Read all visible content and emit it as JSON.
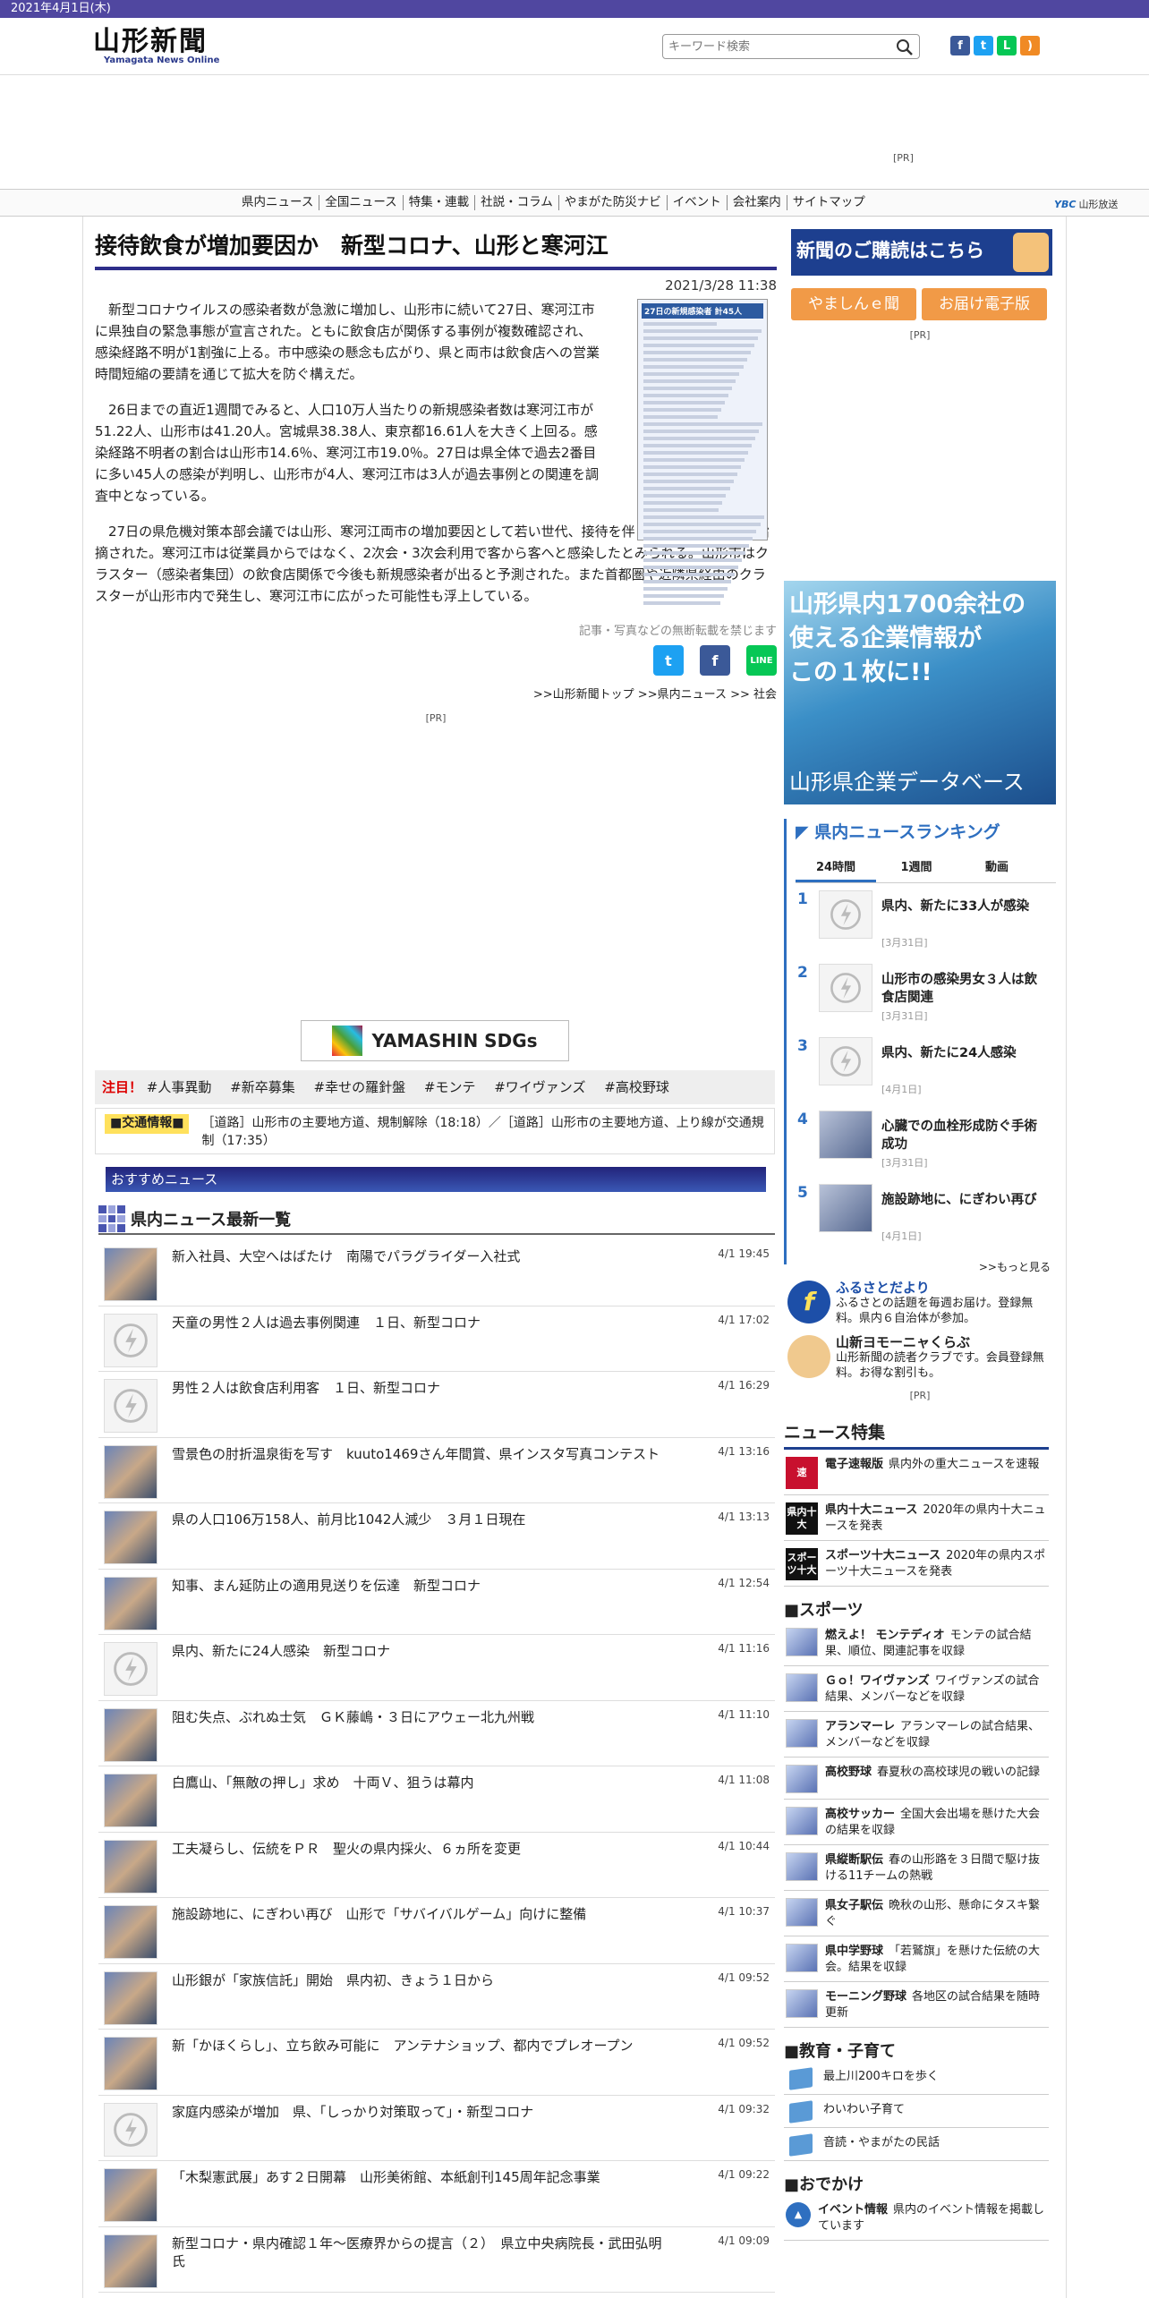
{
  "topbar": {
    "date": "2021年4月1日(木)"
  },
  "header": {
    "logo": "山形新聞",
    "logo_sub": "Yamagata News Online",
    "search_placeholder": "キーワード検索"
  },
  "ads": {
    "pr": "[PR]"
  },
  "nav": {
    "items": [
      "県内ニュース",
      "全国ニュース",
      "特集・連載",
      "社説・コラム",
      "やまがた防災ナビ",
      "イベント",
      "会社案内",
      "サイトマップ"
    ],
    "ybc": "山形放送",
    "ybc_mark": "YBC"
  },
  "article": {
    "title": "接待飲食が増加要因か　新型コロナ、山形と寒河江",
    "date": "2021/3/28 11:38",
    "figure_title": "27日の新規感染者 計45人",
    "paragraphs": [
      "新型コロナウイルスの感染者数が急激に増加し、山形市に続いて27日、寒河江市に県独自の緊急事態が宣言された。ともに飲食店が関係する事例が複数確認され、感染経路不明が1割強に上る。市中感染の懸念も広がり、県と両市は飲食店への営業時間短縮の要請を通じて拡大を防ぐ構えだ。",
      "26日までの直近1週間でみると、人口10万人当たりの新規感染者数は寒河江市が51.22人、山形市は41.20人。宮城県38.38人、東京都16.61人を大きく上回る。感染経路不明者の割合は山形市14.6％、寒河江市19.0％。27日は県全体で過去2番目に多い45人の感染が判明し、山形市が4人、寒河江市は3人が過去事例との関連を調査中となっている。",
      "27日の県危機対策本部会議では山形、寒河江両市の増加要因として若い世代、接待を伴う飲食店での感染が指摘された。寒河江市は従業員からではなく、2次会・3次会利用で客から客へと感染したとみられる。山形市はクラスター（感染者集団）の飲食店関係で今後も新規感染者が出ると予測された。また首都圏や近隣県経由のクラスターが山形市内で発生し、寒河江市に広がった可能性も浮上している。"
    ],
    "no_reprint": "記事・写真などの無断転載を禁じます",
    "breadcrumb": ">>山形新聞トップ >>県内ニュース >> 社会"
  },
  "sdgs": {
    "label": "YAMASHIN SDGs"
  },
  "tags": {
    "label": "注目！",
    "items": [
      "#人事異動",
      "#新卒募集",
      "#幸せの羅針盤",
      "#モンテ",
      "#ワイヴァンズ",
      "#高校野球"
    ]
  },
  "traffic": {
    "label": "■交通情報■",
    "text": "［道路］山形市の主要地方道、規制解除（18:18）／［道路］山形市の主要地方道、上り線が交通規制（17:35）"
  },
  "recommend": {
    "label": "おすすめニュース"
  },
  "news": {
    "heading": "県内ニュース最新一覧",
    "items": [
      {
        "title": "新入社員、大空へはばたけ　南陽でパラグライダー入社式",
        "date": "4/1 19:45",
        "photo": true
      },
      {
        "title": "天童の男性２人は過去事例関連　１日、新型コロナ",
        "date": "4/1 17:02",
        "photo": false
      },
      {
        "title": "男性２人は飲食店利用客　１日、新型コロナ",
        "date": "4/1 16:29",
        "photo": false
      },
      {
        "title": "雪景色の肘折温泉街を写す　kuuto1469さん年間賞、県インスタ写真コンテスト",
        "date": "4/1 13:16",
        "photo": true
      },
      {
        "title": "県の人口106万158人、前月比1042人減少　３月１日現在",
        "date": "4/1 13:13",
        "photo": true
      },
      {
        "title": "知事、まん延防止の適用見送りを伝達　新型コロナ",
        "date": "4/1 12:54",
        "photo": true
      },
      {
        "title": "県内、新たに24人感染　新型コロナ",
        "date": "4/1 11:16",
        "photo": false
      },
      {
        "title": "阻む失点、ぶれぬ士気　ＧＫ藤嶋・３日にアウェー北九州戦",
        "date": "4/1 11:10",
        "photo": true
      },
      {
        "title": "白鷹山、「無敵の押し」求め　十両Ｖ、狙うは幕内",
        "date": "4/1 11:08",
        "photo": true
      },
      {
        "title": "工夫凝らし、伝統をＰＲ　聖火の県内採火、６ヵ所を変更",
        "date": "4/1 10:44",
        "photo": true
      },
      {
        "title": "施設跡地に、にぎわい再び　山形で「サバイバルゲーム」向けに整備",
        "date": "4/1 10:37",
        "photo": true
      },
      {
        "title": "山形銀が「家族信託」開始　県内初、きょう１日から",
        "date": "4/1 09:52",
        "photo": true
      },
      {
        "title": "新「かほくらし」、立ち飲み可能に　アンテナショップ、都内でプレオープン",
        "date": "4/1 09:52",
        "photo": true
      },
      {
        "title": "家庭内感染が増加　県、「しっかり対策取って」・新型コロナ",
        "date": "4/1 09:32",
        "photo": false
      },
      {
        "title": "「木梨憲武展」あす２日開幕　山形美術館、本紙創刊145周年記念事業",
        "date": "4/1 09:22",
        "photo": true
      },
      {
        "title": "新型コロナ・県内確認１年～医療界からの提言（２）　県立中央病院長・武田弘明氏",
        "date": "4/1 09:09",
        "photo": true
      }
    ]
  },
  "sidebar": {
    "subscribe": "新聞のご購読はこちら",
    "buttons": [
      "やましんｅ聞",
      "お届け電子版"
    ],
    "bigad_line1": "山形県内1700余社の",
    "bigad_line2": "使える企業情報が",
    "bigad_line3": "この１枚に!!",
    "bigad_line4": "山形県企業データベース",
    "ranking": {
      "title": "県内ニュースランキング",
      "tabs": [
        "24時間",
        "1週間",
        "動画"
      ],
      "items": [
        {
          "n": "1",
          "title": "県内、新たに33人が感染",
          "date": "[3月31日]",
          "photo": false
        },
        {
          "n": "2",
          "title": "山形市の感染男女３人は飲食店関連",
          "date": "[3月31日]",
          "photo": false
        },
        {
          "n": "3",
          "title": "県内、新たに24人感染",
          "date": "[4月1日]",
          "photo": false
        },
        {
          "n": "4",
          "title": "心臓での血栓形成防ぐ手術成功",
          "date": "[3月31日]",
          "photo": true
        },
        {
          "n": "5",
          "title": "施設跡地に、にぎわい再び",
          "date": "[4月1日]",
          "photo": true
        }
      ],
      "more": ">>もっと見る"
    },
    "furusato": {
      "title": "ふるさとだより",
      "text": "ふるさとの話題を毎週お届け。登録無料。県内６自治体が参加。"
    },
    "club": {
      "title": "山新ヨモーニャくらぶ",
      "text": "山形新聞の読者クラブです。会員登録無料。お得な割引も。"
    },
    "features_title": "ニュース特集",
    "features": [
      {
        "icon": "速",
        "color": "#c8102e",
        "name": "電子速報版",
        "desc": "県内外の重大ニュースを速報"
      },
      {
        "icon": "県内十大",
        "color": "#111",
        "name": "県内十大ニュース",
        "desc": "2020年の県内十大ニュースを発表"
      },
      {
        "icon": "スポーツ十大",
        "color": "#111",
        "name": "スポーツ十大ニュース",
        "desc": "2020年の県内スポーツ十大ニュースを発表"
      }
    ],
    "sports_title": "■スポーツ",
    "sports": [
      {
        "name": "燃えよ！ モンテディオ",
        "desc": "モンテの試合結果、順位、関連記事を収録"
      },
      {
        "name": "Ｇｏ！ワイヴァンズ",
        "desc": "ワイヴァンズの試合結果、メンバーなどを収録"
      },
      {
        "name": "アランマーレ",
        "desc": "アランマーレの試合結果、メンバーなどを収録"
      },
      {
        "name": "高校野球",
        "desc": "春夏秋の高校球児の戦いの記録"
      },
      {
        "name": "高校サッカー",
        "desc": "全国大会出場を懸けた大会の結果を収録"
      },
      {
        "name": "県縦断駅伝",
        "desc": "春の山形路を３日間で駆け抜ける11チームの熱戦"
      },
      {
        "name": "県女子駅伝",
        "desc": "晩秋の山形、懸命にタスキ繋ぐ"
      },
      {
        "name": "県中学野球",
        "desc": "「若鷲旗」を懸けた伝統の大会。結果を収録"
      },
      {
        "name": "モーニング野球",
        "desc": "各地区の試合結果を随時更新"
      }
    ],
    "edu_title": "■教育・子育て",
    "edu": [
      "最上川200キロを歩く",
      "わいわい子育て",
      "音読・やまがたの民話"
    ],
    "outing_title": "■おでかけ",
    "outing": {
      "name": "イベント情報",
      "desc": "県内のイベント情報を掲載しています"
    }
  }
}
